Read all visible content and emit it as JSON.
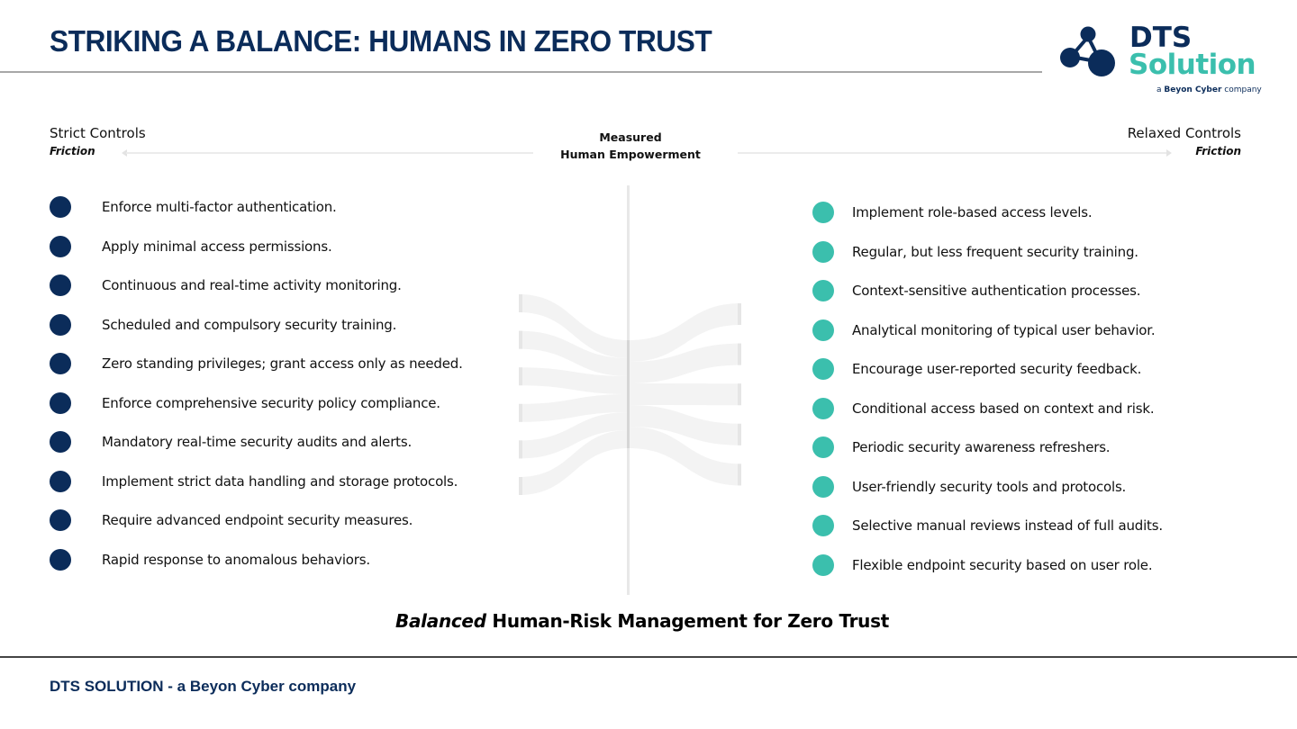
{
  "header": {
    "title": "STRIKING A BALANCE: HUMANS IN ZERO TRUST"
  },
  "logo": {
    "line1": "DTS",
    "line2": "Solution",
    "tagline_prefix": "a ",
    "tagline_brand": "Beyon Cyber",
    "tagline_suffix": " company",
    "icon": "molecule-network-icon"
  },
  "scale": {
    "left_title": "Strict Controls",
    "left_subtitle": "Friction",
    "center_line1": "Measured",
    "center_line2": "Human Empowerment",
    "right_title": "Relaxed Controls",
    "right_subtitle": "Friction"
  },
  "strict_controls": [
    "Enforce multi-factor authentication.",
    "Apply minimal access permissions.",
    "Continuous and real-time activity monitoring.",
    "Scheduled and compulsory security training.",
    "Zero standing privileges; grant access only as needed.",
    "Enforce comprehensive security policy compliance.",
    "Mandatory real-time security audits and alerts.",
    "Implement strict data handling and storage protocols.",
    "Require advanced endpoint security measures.",
    "Rapid response to anomalous behaviors."
  ],
  "relaxed_controls": [
    "Implement role-based access levels.",
    "Regular, but less frequent security training.",
    "Context-sensitive authentication processes.",
    "Analytical monitoring of typical user behavior.",
    "Encourage user-reported security feedback.",
    "Conditional access based on context and risk.",
    "Periodic security awareness refreshers.",
    "User-friendly security tools and protocols.",
    "Selective manual reviews instead of full audits.",
    "Flexible endpoint security based on user role."
  ],
  "flow": {
    "left_streams": 6,
    "right_streams": 5
  },
  "tagline": {
    "emphasis": "Balanced",
    "rest": " Human-Risk Management for Zero Trust"
  },
  "footer": {
    "text": "DTS SOLUTION - a Beyon Cyber company"
  },
  "colors": {
    "navy": "#0b2c5a",
    "teal": "#3bbfad",
    "flow_fill": "#f3f3f3",
    "flow_bar": "#e6e6e6"
  }
}
